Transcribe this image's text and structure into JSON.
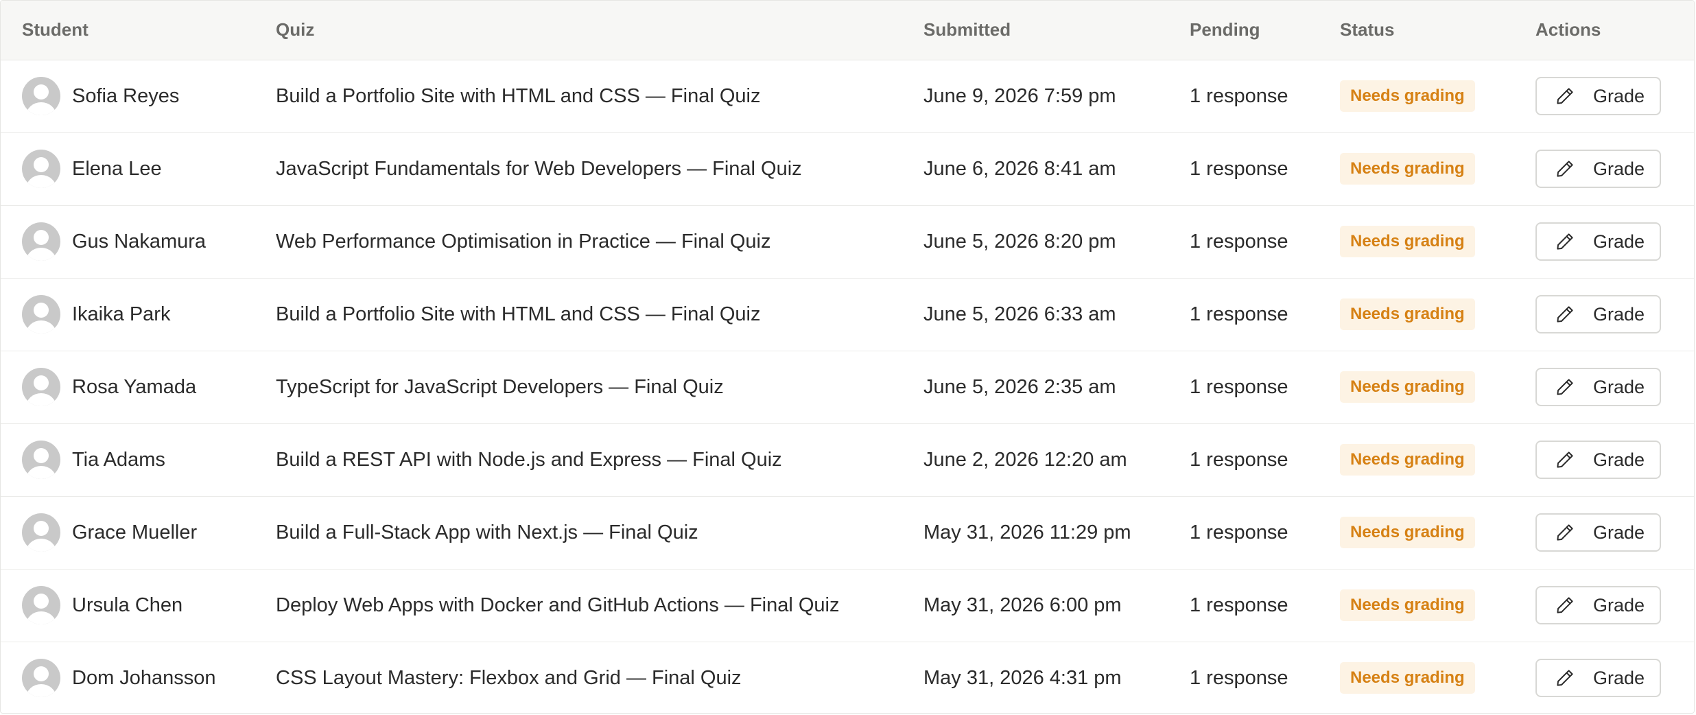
{
  "table": {
    "headers": {
      "student": "Student",
      "quiz": "Quiz",
      "submitted": "Submitted",
      "pending": "Pending",
      "status": "Status",
      "actions": "Actions"
    },
    "rows": [
      {
        "student": "Sofia Reyes",
        "quiz": "Build a Portfolio Site with HTML and CSS — Final Quiz",
        "submitted": "June 9, 2026 7:59 pm",
        "pending": "1 response",
        "status": "Needs grading",
        "action": "Grade"
      },
      {
        "student": "Elena Lee",
        "quiz": "JavaScript Fundamentals for Web Developers — Final Quiz",
        "submitted": "June 6, 2026 8:41 am",
        "pending": "1 response",
        "status": "Needs grading",
        "action": "Grade"
      },
      {
        "student": "Gus Nakamura",
        "quiz": "Web Performance Optimisation in Practice — Final Quiz",
        "submitted": "June 5, 2026 8:20 pm",
        "pending": "1 response",
        "status": "Needs grading",
        "action": "Grade"
      },
      {
        "student": "Ikaika Park",
        "quiz": "Build a Portfolio Site with HTML and CSS — Final Quiz",
        "submitted": "June 5, 2026 6:33 am",
        "pending": "1 response",
        "status": "Needs grading",
        "action": "Grade"
      },
      {
        "student": "Rosa Yamada",
        "quiz": "TypeScript for JavaScript Developers — Final Quiz",
        "submitted": "June 5, 2026 2:35 am",
        "pending": "1 response",
        "status": "Needs grading",
        "action": "Grade"
      },
      {
        "student": "Tia Adams",
        "quiz": "Build a REST API with Node.js and Express — Final Quiz",
        "submitted": "June 2, 2026 12:20 am",
        "pending": "1 response",
        "status": "Needs grading",
        "action": "Grade"
      },
      {
        "student": "Grace Mueller",
        "quiz": "Build a Full-Stack App with Next.js — Final Quiz",
        "submitted": "May 31, 2026 11:29 pm",
        "pending": "1 response",
        "status": "Needs grading",
        "action": "Grade"
      },
      {
        "student": "Ursula Chen",
        "quiz": "Deploy Web Apps with Docker and GitHub Actions — Final Quiz",
        "submitted": "May 31, 2026 6:00 pm",
        "pending": "1 response",
        "status": "Needs grading",
        "action": "Grade"
      },
      {
        "student": "Dom Johansson",
        "quiz": "CSS Layout Mastery: Flexbox and Grid — Final Quiz",
        "submitted": "May 31, 2026 4:31 pm",
        "pending": "1 response",
        "status": "Needs grading",
        "action": "Grade"
      }
    ]
  },
  "icons": {
    "avatar": "user-avatar-placeholder-icon",
    "grade_button": "pencil-icon"
  },
  "colors": {
    "header_bg": "#f7f7f5",
    "header_text": "#6b6b68",
    "status_badge_bg": "#fdf3e4",
    "status_badge_text": "#d68114",
    "avatar_bg": "#c9c9c9",
    "border": "#e6e6e3"
  }
}
